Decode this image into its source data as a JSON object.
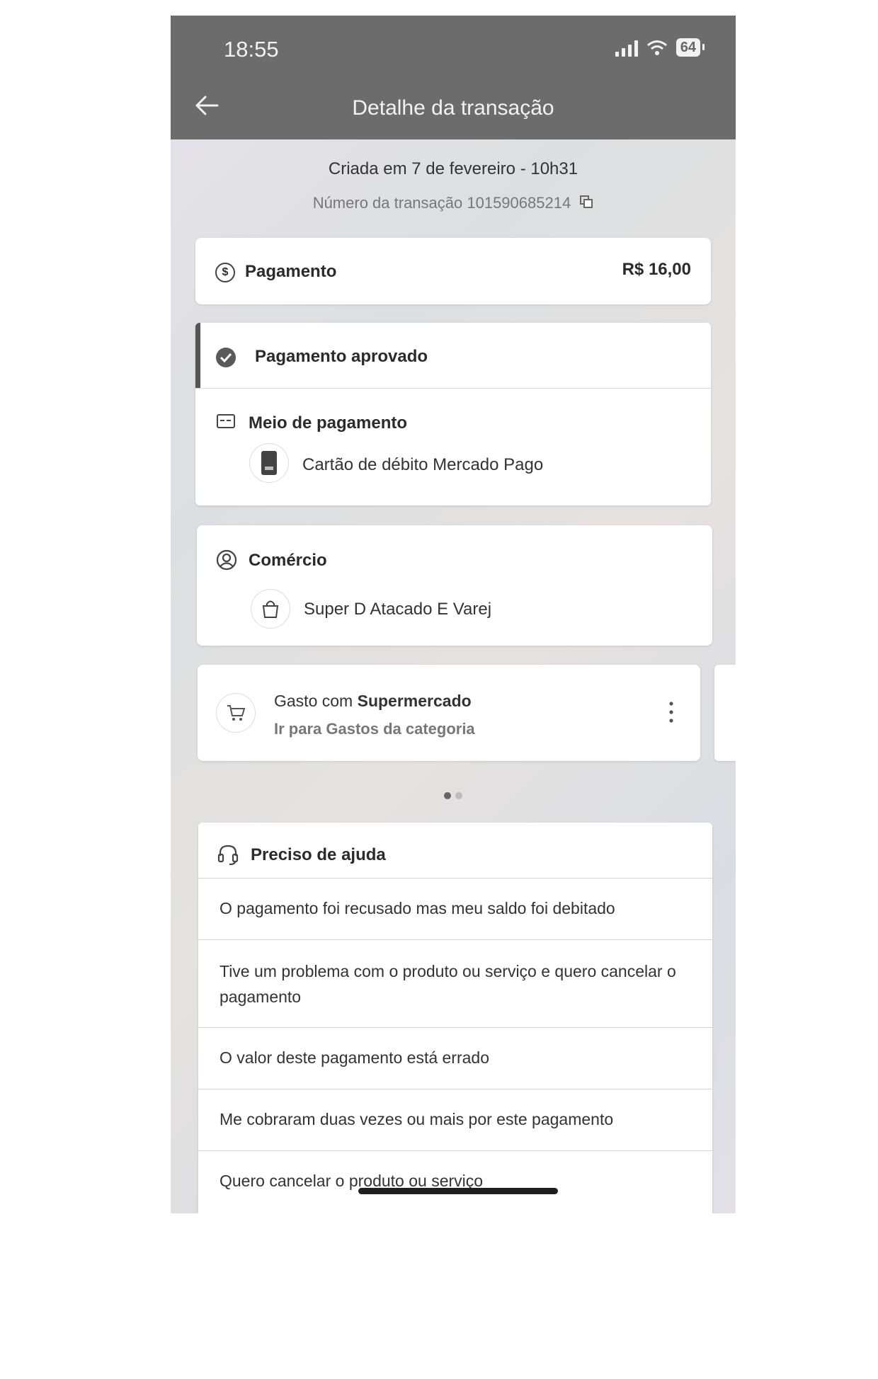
{
  "status_bar": {
    "time": "18:55",
    "battery": "64"
  },
  "header": {
    "title": "Detalhe da transação"
  },
  "meta": {
    "created": "Criada em 7 de fevereiro - 10h31",
    "transaction_number": "Número da transação 101590685214"
  },
  "payment": {
    "label": "Pagamento",
    "amount": "R$ 16,00"
  },
  "status": {
    "label": "Pagamento aprovado"
  },
  "payment_method": {
    "title": "Meio de pagamento",
    "value": "Cartão de débito Mercado Pago"
  },
  "merchant": {
    "title": "Comércio",
    "name": "Super D Atacado E Varej"
  },
  "category": {
    "prefix": "Gasto com",
    "name": "Supermercado",
    "link": "Ir para Gastos da categoria"
  },
  "help": {
    "title": "Preciso de ajuda",
    "items": [
      "O pagamento foi recusado mas meu saldo foi debitado",
      "Tive um problema com o produto ou serviço e quero cancelar o pagamento",
      "O valor deste pagamento está errado",
      "Me cobraram duas vezes ou mais por este pagamento",
      "Quero cancelar o produto ou serviço"
    ]
  }
}
